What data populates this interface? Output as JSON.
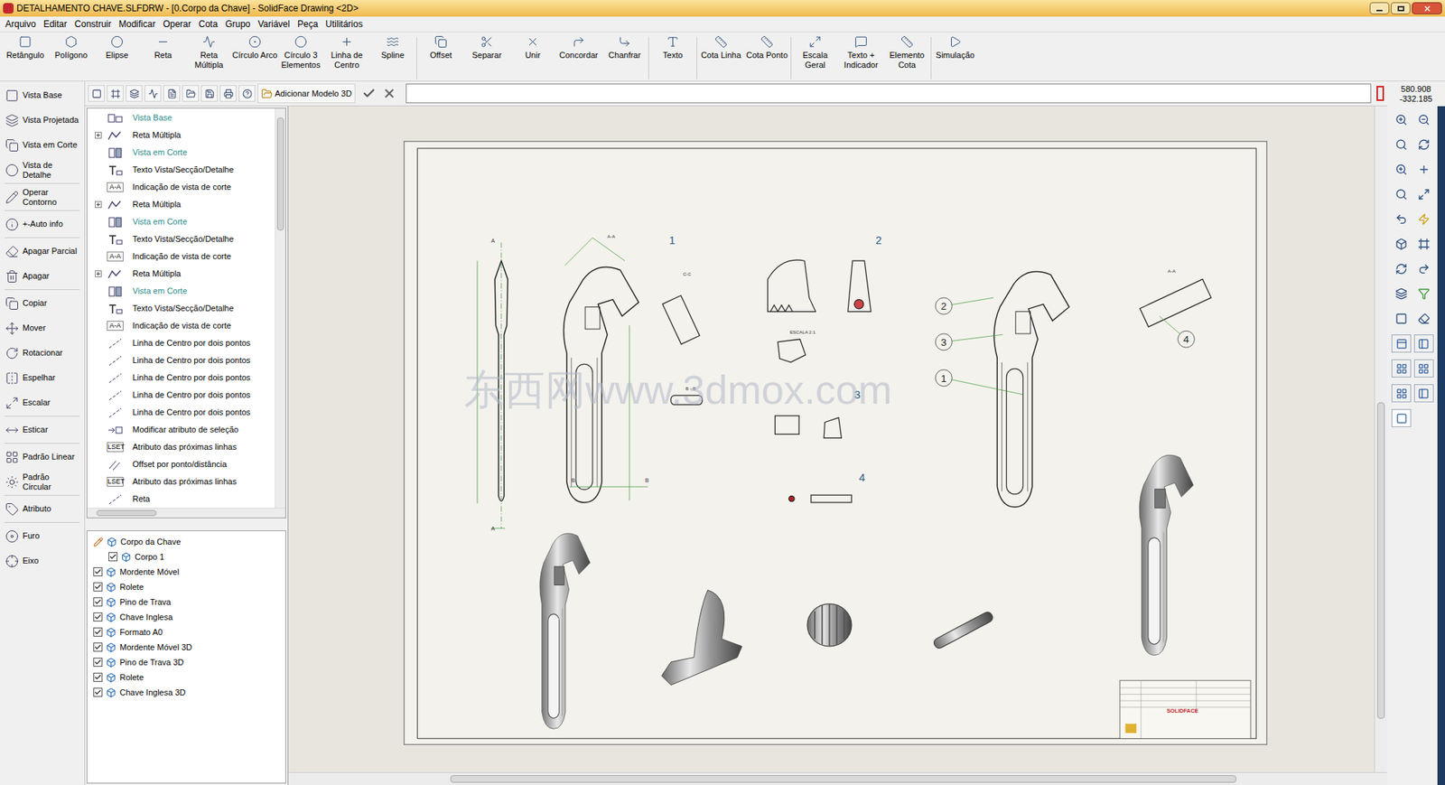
{
  "window": {
    "title": "DETALHAMENTO CHAVE.SLFDRW - [0.Corpo da Chave] - SolidFace Drawing <2D>"
  },
  "menu": [
    "Arquivo",
    "Editar",
    "Construir",
    "Modificar",
    "Operar",
    "Cota",
    "Grupo",
    "Variável",
    "Peça",
    "Utilitários"
  ],
  "toolbar": [
    "Retângulo",
    "Polígono",
    "Elipse",
    "Reta",
    "Reta Múltipla",
    "Círculo Arco",
    "Círculo 3 Elementos",
    "Linha de Centro",
    "Spline",
    "Offset",
    "Separar",
    "Unir",
    "Concordar",
    "Chanfrar",
    "Texto",
    "Cota Linha",
    "Cota Ponto",
    "Escala Geral",
    "Texto + Indicador",
    "Elemento Cota",
    "Simulação"
  ],
  "coordinates": [
    "580.908",
    "-332.185"
  ],
  "left_tools": [
    "Vista Base",
    "Vista Projetada",
    "Vista em Corte",
    "Vista de Detalhe",
    "Operar Contorno",
    "+-Auto info",
    "Apagar Parcial",
    "Apagar",
    "Copiar",
    "Mover",
    "Rotacionar",
    "Espelhar",
    "Escalar",
    "Esticar",
    "Padrão Linear",
    "Padrão Circular",
    "Atributo",
    "Furo",
    "Eixo"
  ],
  "sub_toolbar": {
    "add_model": "Adicionar Modelo 3D",
    "command": ""
  },
  "history": [
    {
      "label": "Vista Base",
      "kind": "view",
      "expandable": false,
      "highlighted": true
    },
    {
      "label": "Reta Múltipla",
      "kind": "multiline",
      "expandable": true,
      "highlighted": false
    },
    {
      "label": "Vista em Corte",
      "kind": "section",
      "expandable": false,
      "highlighted": true
    },
    {
      "label": "Texto Vista/Secção/Detalhe",
      "kind": "text",
      "expandable": false,
      "highlighted": false
    },
    {
      "label": "Indicação de vista de corte",
      "kind": "badge",
      "badge": "A-A",
      "expandable": false,
      "highlighted": false
    },
    {
      "label": "Reta Múltipla",
      "kind": "multiline",
      "expandable": true,
      "highlighted": false
    },
    {
      "label": "Vista em Corte",
      "kind": "section",
      "expandable": false,
      "highlighted": true
    },
    {
      "label": "Texto Vista/Secção/Detalhe",
      "kind": "text",
      "expandable": false,
      "highlighted": false
    },
    {
      "label": "Indicação de vista de corte",
      "kind": "badge",
      "badge": "A-A",
      "expandable": false,
      "highlighted": false
    },
    {
      "label": "Reta Múltipla",
      "kind": "multiline",
      "expandable": true,
      "highlighted": false
    },
    {
      "label": "Vista em Corte",
      "kind": "section",
      "expandable": false,
      "highlighted": true
    },
    {
      "label": "Texto Vista/Secção/Detalhe",
      "kind": "text",
      "expandable": false,
      "highlighted": false
    },
    {
      "label": "Indicação de vista de corte",
      "kind": "badge",
      "badge": "A-A",
      "expandable": false,
      "highlighted": false
    },
    {
      "label": "Linha de Centro por dois pontos",
      "kind": "centerline",
      "expandable": false,
      "highlighted": false
    },
    {
      "label": "Linha de Centro por dois pontos",
      "kind": "centerline",
      "expandable": false,
      "highlighted": false
    },
    {
      "label": "Linha de Centro por dois pontos",
      "kind": "centerline",
      "expandable": false,
      "highlighted": false
    },
    {
      "label": "Linha de Centro por dois pontos",
      "kind": "centerline",
      "expandable": false,
      "highlighted": false
    },
    {
      "label": "Linha de Centro por dois pontos",
      "kind": "centerline",
      "expandable": false,
      "highlighted": false
    },
    {
      "label": "Modificar atributo de seleção",
      "kind": "attr",
      "expandable": false,
      "highlighted": false
    },
    {
      "label": "Atributo das próximas linhas",
      "kind": "badge",
      "badge": "LSET",
      "expandable": false,
      "highlighted": false
    },
    {
      "label": "Offset por ponto/distância",
      "kind": "offset",
      "expandable": false,
      "highlighted": false
    },
    {
      "label": "Atributo das próximas linhas",
      "kind": "badge",
      "badge": "LSET",
      "expandable": false,
      "highlighted": false
    },
    {
      "label": "Reta",
      "kind": "centerline",
      "expandable": false,
      "highlighted": false
    }
  ],
  "parts": [
    {
      "label": "Corpo da Chave",
      "kind": "active",
      "checked": false,
      "indent": false
    },
    {
      "label": "Corpo 1",
      "kind": "part",
      "checked": true,
      "indent": true
    },
    {
      "label": "Mordente Móvel",
      "kind": "part",
      "checked": true,
      "indent": false
    },
    {
      "label": "Rolete",
      "kind": "part",
      "checked": true,
      "indent": false
    },
    {
      "label": "Pino de Trava",
      "kind": "part",
      "checked": true,
      "indent": false
    },
    {
      "label": "Chave Inglesa",
      "kind": "part",
      "checked": true,
      "indent": false
    },
    {
      "label": "Formato A0",
      "kind": "part",
      "checked": true,
      "indent": false
    },
    {
      "label": "Mordente Móvel 3D",
      "kind": "part",
      "checked": true,
      "indent": false
    },
    {
      "label": "Pino de Trava 3D",
      "kind": "part",
      "checked": true,
      "indent": false
    },
    {
      "label": "Rolete",
      "kind": "part",
      "checked": true,
      "indent": false
    },
    {
      "label": "Chave Inglesa 3D",
      "kind": "part",
      "checked": true,
      "indent": false
    }
  ],
  "drawing": {
    "view_numbers": [
      "1",
      "2",
      "3",
      "4"
    ],
    "balloons": [
      "2",
      "3",
      "1",
      "4"
    ],
    "section_labels": [
      "A-A",
      "C-C",
      "B - B",
      "A-A",
      "ESCALA 2:1"
    ],
    "section_marks": [
      "A",
      "A",
      "B",
      "B"
    ],
    "watermark": "东西网www.3dmox.com",
    "brand": "SOLIDFACE"
  }
}
